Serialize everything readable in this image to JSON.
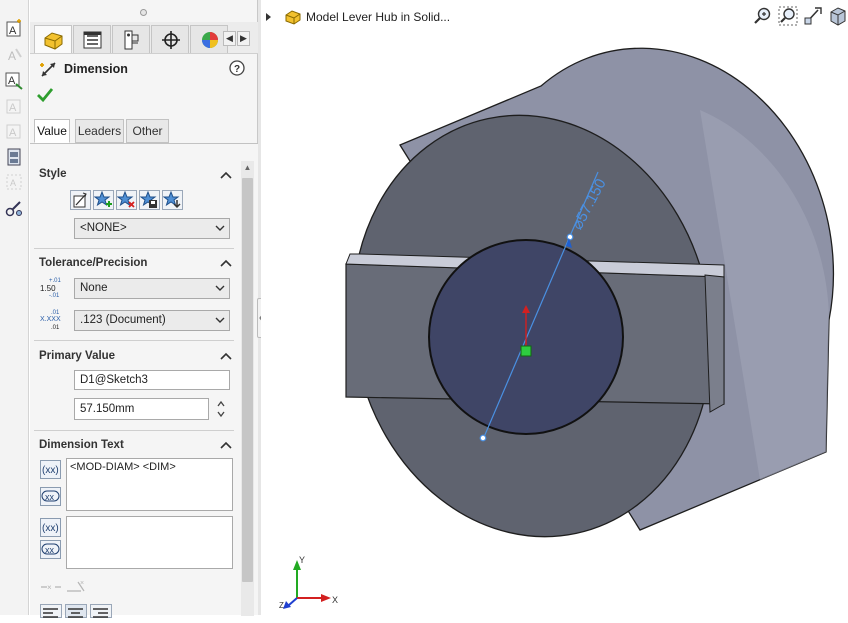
{
  "panel": {
    "title": "Dimension",
    "tabs": [
      "Value",
      "Leaders",
      "Other"
    ],
    "active_tab": "Value"
  },
  "style_group": {
    "title": "Style",
    "style_value": "<NONE>"
  },
  "tolerance_group": {
    "title": "Tolerance/Precision",
    "tolerance_type": "None",
    "precision": ".123 (Document)",
    "tol_icon_text": [
      "+.01",
      "1.50",
      "-.01"
    ],
    "prec_icon_text": [
      ".01",
      "X.XXX",
      ".01"
    ]
  },
  "primary_value_group": {
    "title": "Primary Value",
    "name": "D1@Sketch3",
    "value": "57.150mm"
  },
  "dimension_text_group": {
    "title": "Dimension Text",
    "text_above": "<MOD-DIAM> <DIM>",
    "text_below": ""
  },
  "viewport": {
    "document_title": "Model Lever Hub in Solid...",
    "dimension_label": "⌀57.150",
    "colors": {
      "dimension": "#4a90e2",
      "body_front": "#5f636f",
      "body_side": "#8e92a6",
      "hole_fill": "#3f4566"
    }
  },
  "triad": {
    "x": "X",
    "y": "Y",
    "z": "Z"
  }
}
